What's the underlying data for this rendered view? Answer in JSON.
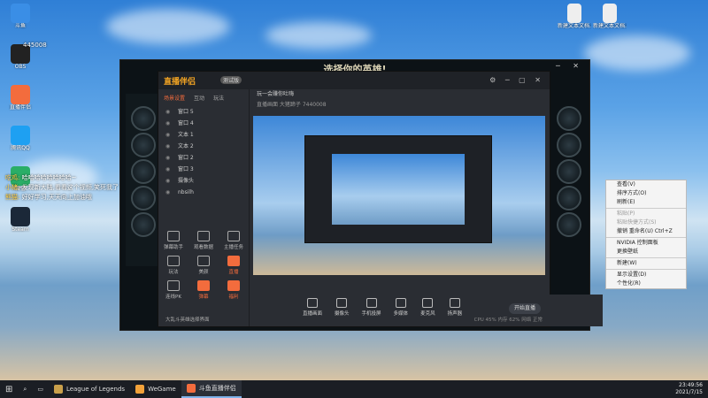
{
  "desktop": {
    "icons_left": [
      {
        "label": "斗鱼",
        "color": "#3a8ee6"
      },
      {
        "label": "OBS",
        "color": "#222222"
      },
      {
        "label": "直播伴侣",
        "color": "#f36c3d"
      },
      {
        "label": "腾讯QQ",
        "color": "#1ea0f2"
      },
      {
        "label": "微信",
        "color": "#2aae67"
      },
      {
        "label": "Steam",
        "color": "#1b2838"
      }
    ],
    "icons_right": [
      {
        "label": "新建文本文档.txt",
        "color": "#eeeeee"
      },
      {
        "label": "新建文本文档.txt",
        "color": "#eeeeee"
      }
    ],
    "overlay_counter": "445008"
  },
  "danmu": [
    {
      "user": "吃鸡",
      "text": "哈哈哈哈哈哈哈哈~"
    },
    {
      "user": "小猪",
      "text": "发现新大陆,看看这个视频,笑死我了"
    },
    {
      "user": "熊猫",
      "text": "好好学习,天天向上加油哦"
    }
  ],
  "game": {
    "title": "选择你的英雄!",
    "window_controls": "─ ✕"
  },
  "app": {
    "logo": "直播伴侣",
    "tag": "测试版",
    "side_tabs": [
      "场景设置",
      "互动",
      "玩法"
    ],
    "scenes": [
      "窗口 5",
      "窗口 4",
      "文本 1",
      "文本 2",
      "窗口 2",
      "窗口 3",
      "摄像头",
      "nbsilh"
    ],
    "tools": [
      {
        "label": "弹幕助手",
        "hot": false
      },
      {
        "label": "观看数据",
        "hot": false
      },
      {
        "label": "主播任务",
        "hot": false
      },
      {
        "label": "玩法",
        "hot": false
      },
      {
        "label": "美颜",
        "hot": false
      },
      {
        "label": "直播",
        "hot": true
      },
      {
        "label": "连线PK",
        "hot": false
      },
      {
        "label": "弹幕",
        "hot": true
      },
      {
        "label": "福利",
        "hot": true
      }
    ],
    "main_top": "玩一会赚你吐嗨",
    "main_sub": "直播画面  大猪蹄子  7440008",
    "bottom_buttons": [
      "直播画面",
      "摄像头",
      "手机投屏",
      "多媒体",
      "麦克风",
      "扬声器"
    ],
    "start_label": "开始直播",
    "status": "CPU 45%  内存 62%  网络 正常",
    "game_icon_bottom": "大乱斗英雄选择界面"
  },
  "context_menu": {
    "items": [
      {
        "label": "查看(V)",
        "disabled": false
      },
      {
        "label": "排序方式(O)",
        "disabled": false
      },
      {
        "label": "刷新(E)",
        "disabled": false
      },
      {
        "label": "sep"
      },
      {
        "label": "粘贴(P)",
        "disabled": true
      },
      {
        "label": "粘贴快捷方式(S)",
        "disabled": true
      },
      {
        "label": "撤销 重命名(U)  Ctrl+Z",
        "disabled": false
      },
      {
        "label": "sep"
      },
      {
        "label": "NVIDIA 控制面板",
        "disabled": false
      },
      {
        "label": "更换壁纸",
        "disabled": false
      },
      {
        "label": "sep"
      },
      {
        "label": "新建(W)",
        "disabled": false
      },
      {
        "label": "sep"
      },
      {
        "label": "显示设置(D)",
        "disabled": false
      },
      {
        "label": "个性化(R)",
        "disabled": false
      }
    ]
  },
  "taskbar": {
    "items": [
      {
        "label": "League of Legends",
        "color": "#c9a04b",
        "active": false
      },
      {
        "label": "WeGame",
        "color": "#f2a23a",
        "active": false
      },
      {
        "label": "斗鱼直播伴侣",
        "color": "#f36c3d",
        "active": true
      }
    ],
    "time": "23:49:56",
    "date": "2021/7/15"
  }
}
